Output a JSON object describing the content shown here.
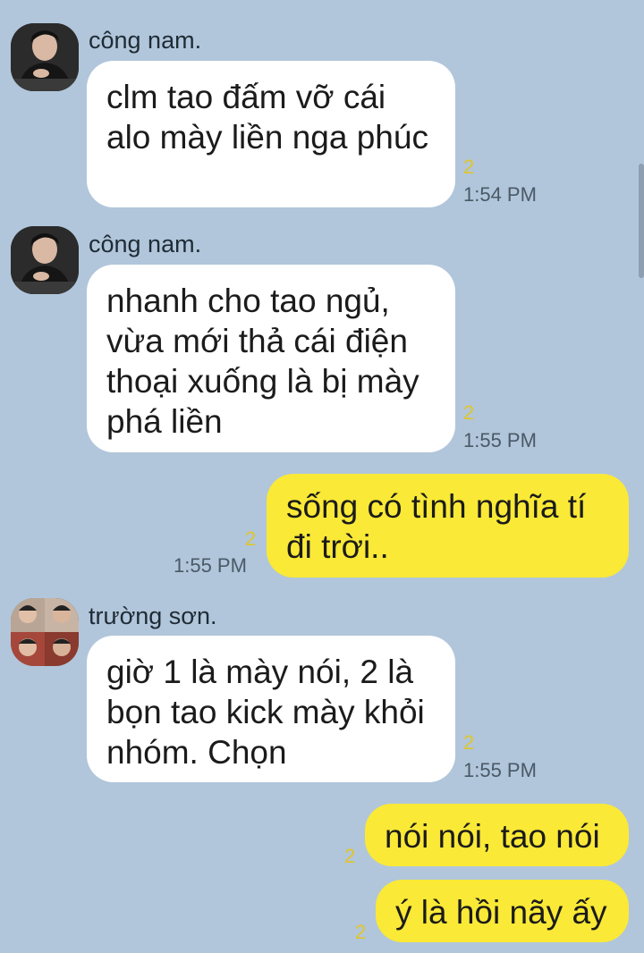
{
  "messages": [
    {
      "sender": "công nam.",
      "text": "clm tao đấm vỡ cái alo mày liền nga phúc",
      "read_count": "2",
      "time": "1:54 PM"
    },
    {
      "sender": "công nam.",
      "text": "nhanh cho tao ngủ, vừa mới thả cái điện thoại xuống là bị mày phá liền",
      "read_count": "2",
      "time": "1:55 PM"
    },
    {
      "sender": "",
      "text": "sống có tình nghĩa tí đi trời..",
      "read_count": "2",
      "time": "1:55 PM"
    },
    {
      "sender": "trường sơn.",
      "text": "giờ 1 là mày nói, 2 là bọn tao kick mày khỏi nhóm. Chọn",
      "read_count": "2",
      "time": "1:55 PM"
    },
    {
      "sender": "",
      "text": "nói nói, tao nói",
      "read_count": "2",
      "time": ""
    },
    {
      "sender": "",
      "text": "ý là hồi nãy ấy",
      "read_count": "2",
      "time": ""
    }
  ],
  "colors": {
    "background": "#b1c6db",
    "incoming_bubble": "#ffffff",
    "outgoing_bubble": "#fae936",
    "read_count": "#e0c52a"
  }
}
